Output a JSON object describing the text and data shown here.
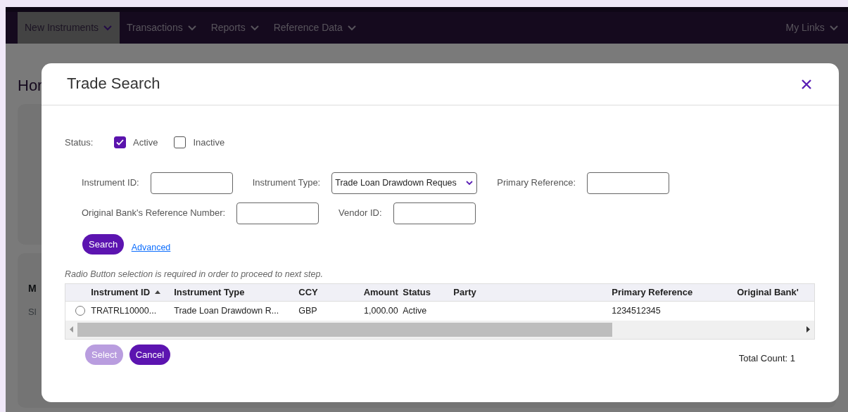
{
  "navbar": {
    "items": [
      {
        "label": "New Instruments",
        "selected": true
      },
      {
        "label": "Transactions",
        "selected": false
      },
      {
        "label": "Reports",
        "selected": false
      },
      {
        "label": "Reference Data",
        "selected": false
      }
    ],
    "my_links": "My Links"
  },
  "background": {
    "heading": "Hor",
    "card_label": "M",
    "card_text": "Sl"
  },
  "modal": {
    "title": "Trade Search",
    "status": {
      "label": "Status:",
      "options": [
        {
          "label": "Active",
          "checked": true
        },
        {
          "label": "Inactive",
          "checked": false
        }
      ]
    },
    "field_rows": [
      [
        {
          "label": "Instrument ID:",
          "kind": "text"
        },
        {
          "label": "Instrument Type:",
          "kind": "select",
          "value": "Trade Loan Drawdown Reques"
        },
        {
          "label": "Primary Reference:",
          "kind": "text"
        }
      ],
      [
        {
          "label": "Original Bank's Reference Number:",
          "kind": "text"
        },
        {
          "label": "Vendor ID:",
          "kind": "text"
        }
      ]
    ],
    "search_button": "Search",
    "advanced_link": "Advanced",
    "note": "Radio Button selection is required in order to proceed to next step.",
    "table": {
      "columns": [
        {
          "label": "Instrument ID",
          "sorted": true
        },
        {
          "label": "Instrument Type",
          "sorted": false
        },
        {
          "label": "CCY",
          "sorted": false
        },
        {
          "label": "Amount",
          "sorted": false
        },
        {
          "label": "Status",
          "sorted": false
        },
        {
          "label": "Party",
          "sorted": false
        },
        {
          "label": "Primary Reference",
          "sorted": false
        },
        {
          "label": "Original Bank'",
          "sorted": false
        }
      ],
      "rows": [
        {
          "selected": false,
          "cells": [
            "TRATRL10000...",
            "Trade Loan Drawdown R...",
            "GBP",
            "1,000.00",
            "Active",
            "",
            "1234512345",
            ""
          ]
        }
      ]
    },
    "buttons": [
      {
        "label": "Select",
        "disabled": true
      },
      {
        "label": "Cancel",
        "disabled": false
      }
    ],
    "total_count": "Total Count: 1"
  }
}
